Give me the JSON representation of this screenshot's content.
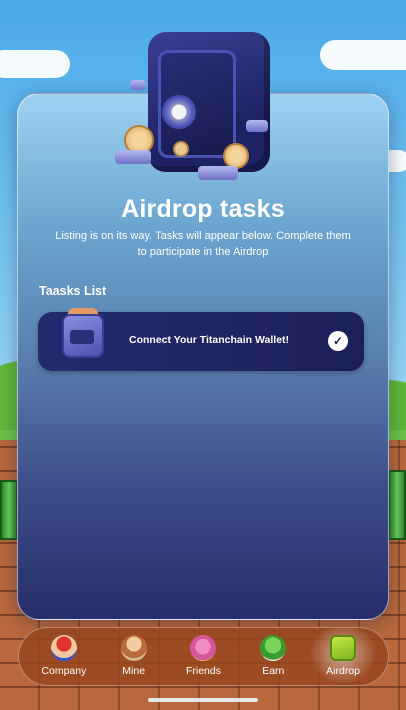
{
  "header": {
    "title": "Airdrop tasks",
    "subtitle": "Listing is on its way. Tasks will appear below. Complete them to participate in the Airdrop"
  },
  "tasks": {
    "section_label": "Taasks List",
    "items": [
      {
        "label": "Connect Your Titanchain Wallet!",
        "status_icon": "check-icon",
        "done": true
      }
    ]
  },
  "nav": {
    "items": [
      {
        "label": "Company",
        "icon": "company-character-icon",
        "active": false
      },
      {
        "label": "Mine",
        "icon": "mine-character-icon",
        "active": false
      },
      {
        "label": "Friends",
        "icon": "friends-character-icon",
        "active": false
      },
      {
        "label": "Earn",
        "icon": "earn-character-icon",
        "active": false
      },
      {
        "label": "Airdrop",
        "icon": "wallet-icon",
        "active": true
      }
    ]
  },
  "colors": {
    "card_top": "#9fd2f1",
    "card_bottom": "#262d6a",
    "task_bg": "#1c1f58",
    "nav_bg": "#96461e",
    "accent_gold": "#d4a25a"
  }
}
